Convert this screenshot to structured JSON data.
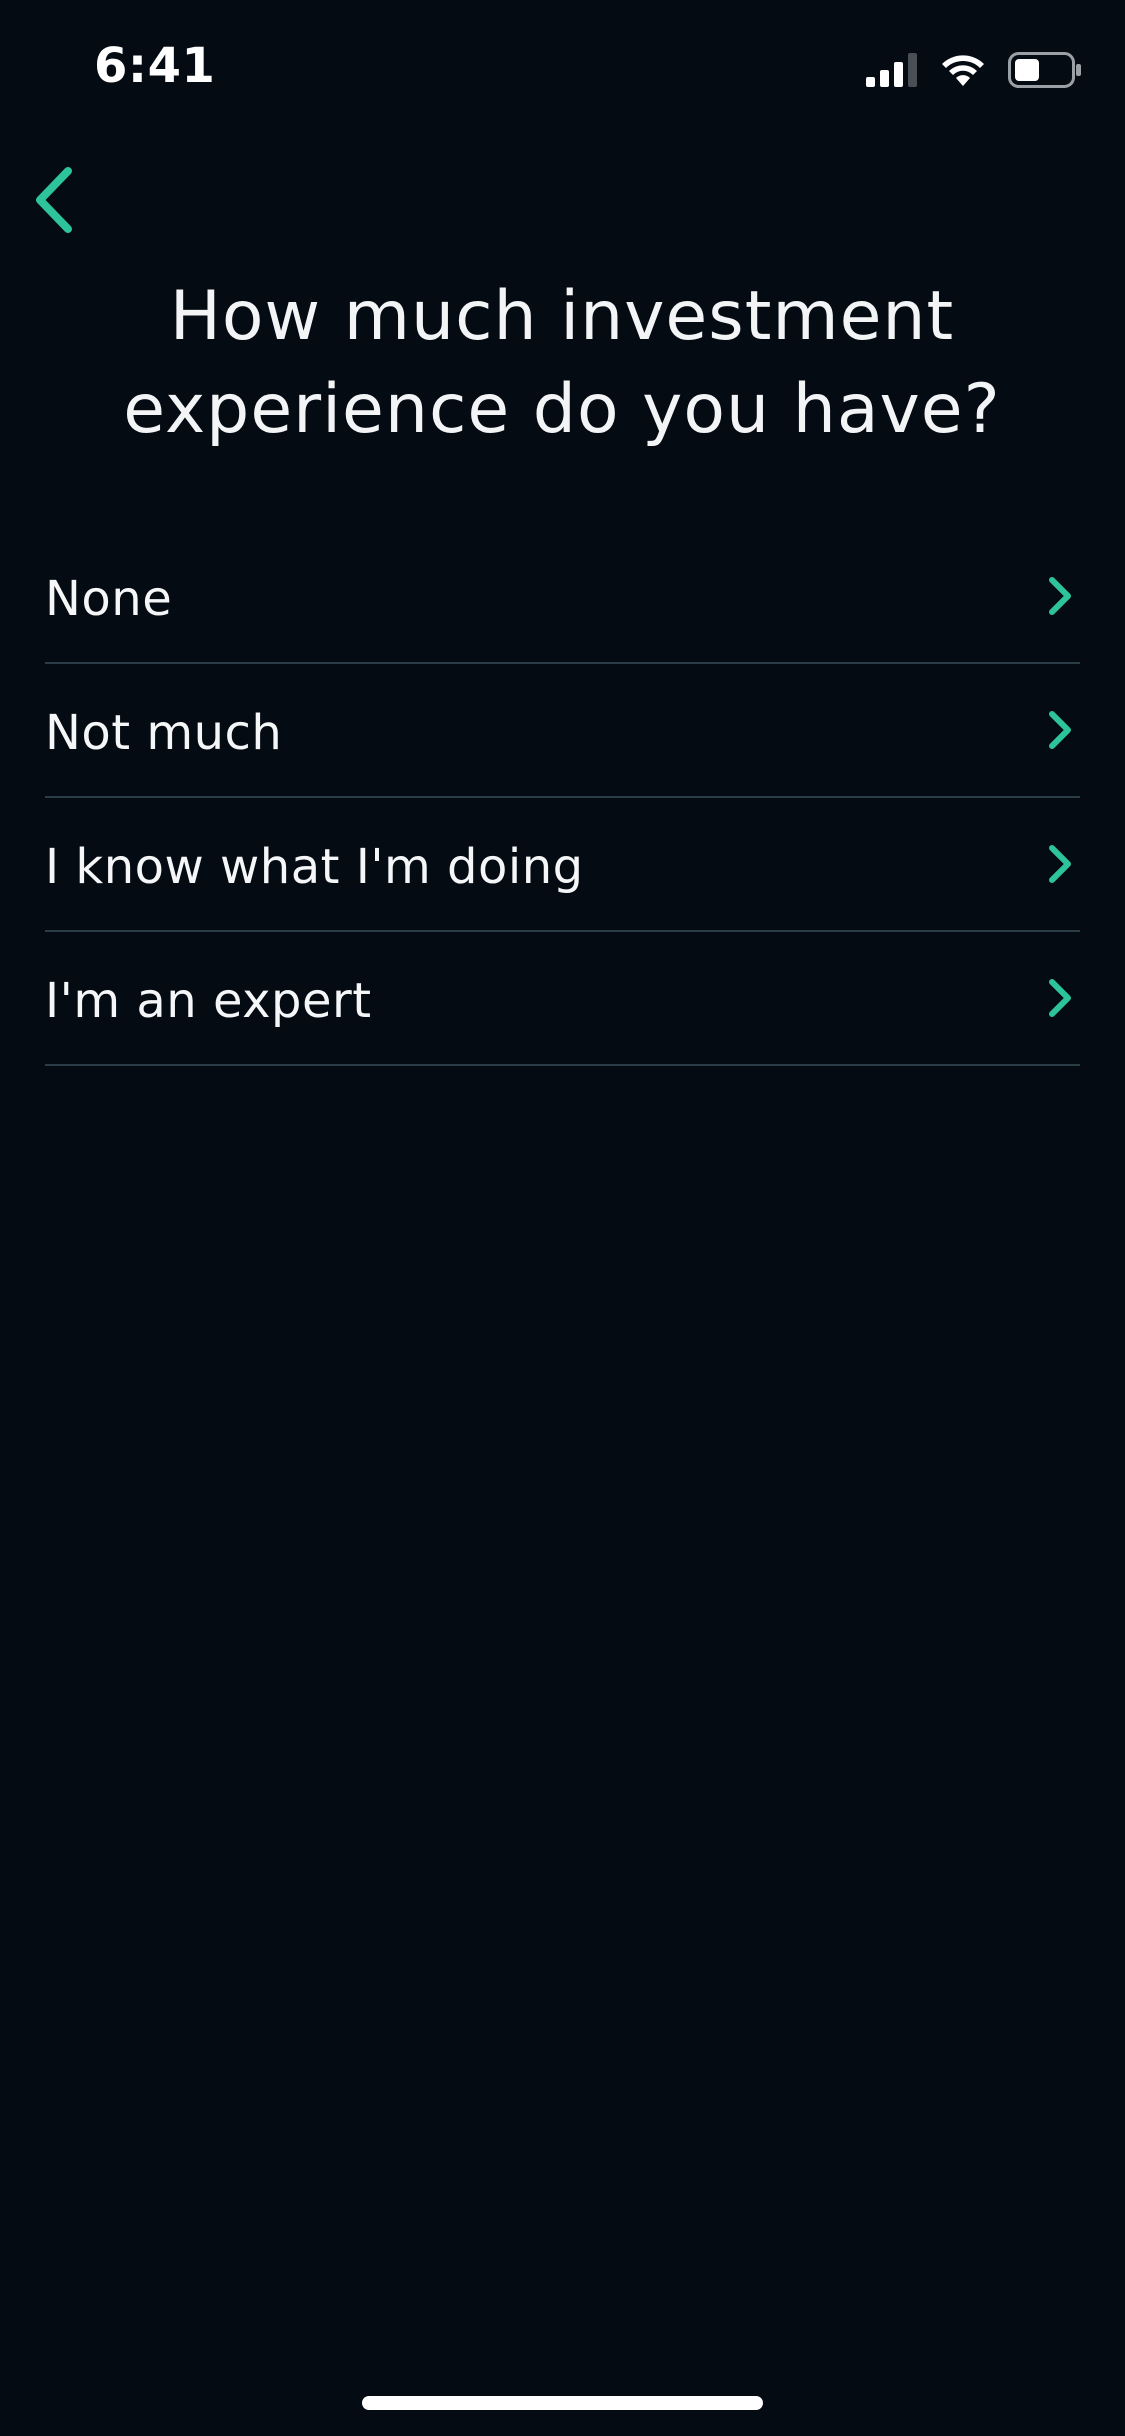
{
  "status_bar": {
    "time": "6:41",
    "icons": [
      "cellular-signal-icon",
      "wifi-icon",
      "battery-icon"
    ]
  },
  "navigation": {
    "back_icon": "chevron-left-icon"
  },
  "question": {
    "title": "How much investment experience do you have?"
  },
  "options": [
    {
      "label": "None",
      "icon": "chevron-right-icon"
    },
    {
      "label": "Not much",
      "icon": "chevron-right-icon"
    },
    {
      "label": "I know what I'm doing",
      "icon": "chevron-right-icon"
    },
    {
      "label": "I'm an expert",
      "icon": "chevron-right-icon"
    }
  ],
  "colors": {
    "background": "#050b13",
    "accent": "#2ec49b",
    "text": "#f4f6f8",
    "divider": "#2a3c45"
  }
}
